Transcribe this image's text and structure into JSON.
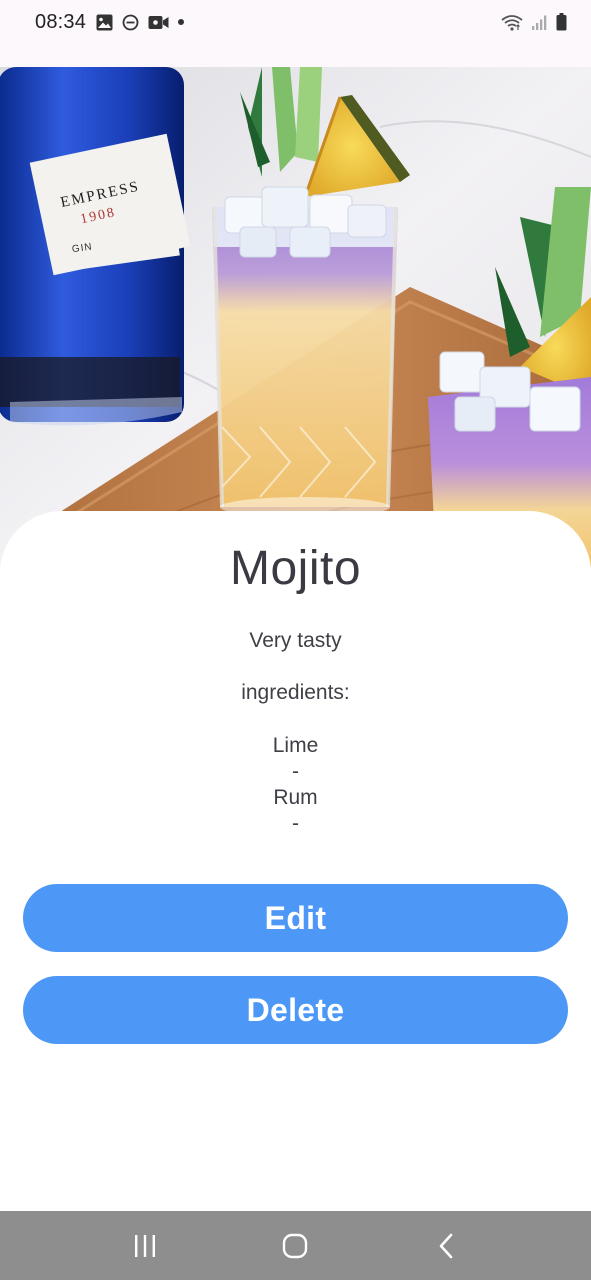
{
  "status_bar": {
    "time": "08:34",
    "left_icons": [
      "image-icon",
      "do-not-disturb-icon",
      "video-camera-icon",
      "notification-dot-icon"
    ],
    "right_icons": [
      "wifi-icon",
      "signal-icon",
      "battery-icon"
    ]
  },
  "hero": {
    "image": "cocktail-photo"
  },
  "cocktail": {
    "name": "Mojito",
    "description": "Very tasty",
    "ingredients_label": "ingredients:",
    "ingredients": [
      {
        "name": "Lime",
        "separator": "-"
      },
      {
        "name": "Rum",
        "separator": "-"
      }
    ]
  },
  "actions": {
    "edit_label": "Edit",
    "delete_label": "Delete"
  },
  "colors": {
    "button": "#4d98f7",
    "nav_bar": "#8e8e8e",
    "status_bar": "#fdf8fc"
  },
  "nav_bar": {
    "buttons": [
      "recents-icon",
      "home-icon",
      "back-icon"
    ]
  }
}
